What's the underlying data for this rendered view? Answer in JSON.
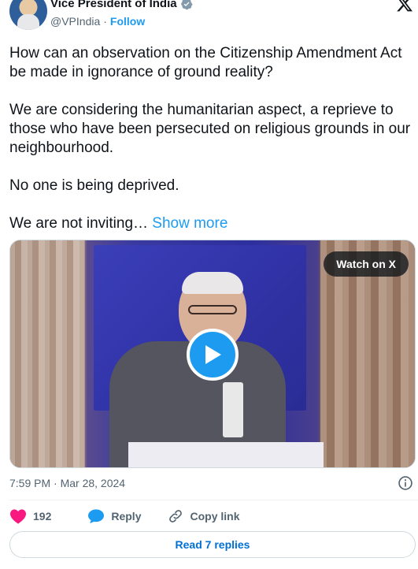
{
  "author": {
    "name": "Vice President of India",
    "handle": "@VPIndia",
    "separator": "·",
    "follow_label": "Follow"
  },
  "tweet": {
    "paragraphs": [
      "How can an observation on the Citizenship Amendment Act be made in ignorance of ground reality?",
      "We are considering the humanitarian aspect, a reprieve to those who have been persecuted on religious grounds in our neighbourhood.",
      "No one is being deprived."
    ],
    "truncated_text": "We are not inviting… ",
    "show_more_label": "Show more"
  },
  "media": {
    "watch_label": "Watch on X"
  },
  "timestamp": "7:59 PM · Mar 28, 2024",
  "actions": {
    "likes_count": "192",
    "reply_label": "Reply",
    "copy_link_label": "Copy link"
  },
  "read_replies_label": "Read 7 replies",
  "colors": {
    "accent": "#1d9bf0",
    "like": "#f91880",
    "muted": "#536471"
  }
}
